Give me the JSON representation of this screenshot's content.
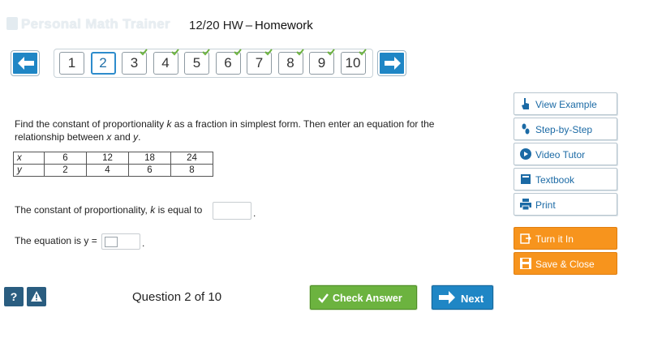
{
  "header": {
    "brand": "Personal Math Trainer",
    "assignment_date": "12/20 HW",
    "assignment_name": "Homework"
  },
  "nav": {
    "questions": [
      {
        "label": "1",
        "completed": false,
        "current": false
      },
      {
        "label": "2",
        "completed": false,
        "current": true
      },
      {
        "label": "3",
        "completed": true,
        "current": false
      },
      {
        "label": "4",
        "completed": true,
        "current": false
      },
      {
        "label": "5",
        "completed": true,
        "current": false
      },
      {
        "label": "6",
        "completed": true,
        "current": false
      },
      {
        "label": "7",
        "completed": true,
        "current": false
      },
      {
        "label": "8",
        "completed": true,
        "current": false
      },
      {
        "label": "9",
        "completed": true,
        "current": false
      },
      {
        "label": "10",
        "completed": true,
        "current": false
      }
    ]
  },
  "question": {
    "text_part1": "Find the constant of proportionality",
    "k_var": "k",
    "text_part2": "as a fraction in simplest form. Then enter an equation for the relationship between",
    "x_var": "x",
    "and_word": "and",
    "y_var": "y",
    "period": "."
  },
  "table": {
    "x_label": "x",
    "y_label": "y",
    "x_values": [
      "6",
      "12",
      "18",
      "24"
    ],
    "y_values": [
      "2",
      "4",
      "6",
      "8"
    ]
  },
  "answers": {
    "line1_text": "The constant of proportionality,",
    "line1_k": "k",
    "line1_suffix": "is equal to",
    "line1_end": ".",
    "line2_text": "The equation is y =",
    "line2_end": "."
  },
  "sidebar": {
    "view_example": "View Example",
    "step_by_step": "Step-by-Step",
    "video_tutor": "Video Tutor",
    "textbook": "Textbook",
    "print": "Print",
    "turn_it_in": "Turn it In",
    "save_close": "Save & Close"
  },
  "footer": {
    "help": "?",
    "question_count": "Question 2 of 10",
    "check_answer": "Check Answer",
    "next": "Next"
  },
  "colors": {
    "primary_blue": "#1f86c5",
    "check_green": "#6cb33f",
    "orange": "#f7941d",
    "dark_blue": "#2a5d80"
  }
}
